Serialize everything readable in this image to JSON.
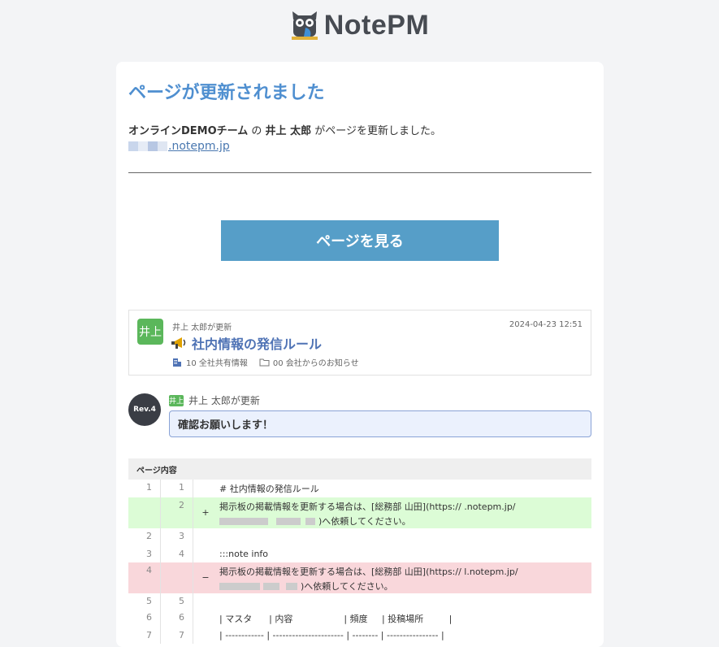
{
  "brand": {
    "name": "NotePM",
    "icon": "owl-logo-icon"
  },
  "email": {
    "title": "ページが更新されました",
    "team": "オンラインDEMOチーム",
    "joiner1": " の ",
    "user": "井上 太郎",
    "joiner2": " がページを更新しました。",
    "domain_suffix": ".notepm.jp",
    "button_label": "ページを見る"
  },
  "page_card": {
    "avatar": "井上",
    "updated_by": "井上 太郎が更新",
    "timestamp": "2024-04-23 12:51",
    "title_icon": "megaphone-icon",
    "title": "社内情報の発信ルール",
    "notebook": "10 全社共有情報",
    "folder": "00 会社からのお知らせ"
  },
  "revision": {
    "label": "Rev.4",
    "avatar": "井上",
    "updated_by": "井上 太郎が更新",
    "comment": "確認お願いします！"
  },
  "diff": {
    "header": "ページ内容",
    "rows": [
      {
        "old": "1",
        "new": "1",
        "sign": "",
        "type": "ctx",
        "line1": "# 社内情報の発信ルール"
      },
      {
        "old": "",
        "new": "2",
        "sign": "+",
        "type": "add",
        "line1": "掲示板の掲載情報を更新する場合は、[総務部 山田](https://          .notepm.jp/",
        "line2": ")へ依頼してください。"
      },
      {
        "old": "2",
        "new": "3",
        "sign": "",
        "type": "ctx",
        "line1": ""
      },
      {
        "old": "3",
        "new": "4",
        "sign": "",
        "type": "ctx",
        "line1": ":::note info"
      },
      {
        "old": "4",
        "new": "",
        "sign": "−",
        "type": "del",
        "line1": "掲示板の掲載情報を更新する場合は、[総務部 山田](https://       l.notepm.jp/",
        "line2": ")へ依頼してください。"
      },
      {
        "old": "5",
        "new": "5",
        "sign": "",
        "type": "ctx",
        "line1": ""
      },
      {
        "old": "6",
        "new": "6",
        "sign": "",
        "type": "ctx",
        "line1": "| マスタ      | 内容                  | 頻度     | 投稿場所         |"
      },
      {
        "old": "7",
        "new": "7",
        "sign": "",
        "type": "ctx",
        "line1": "| ------------ | ---------------------- | -------- | ---------------- |"
      }
    ]
  }
}
